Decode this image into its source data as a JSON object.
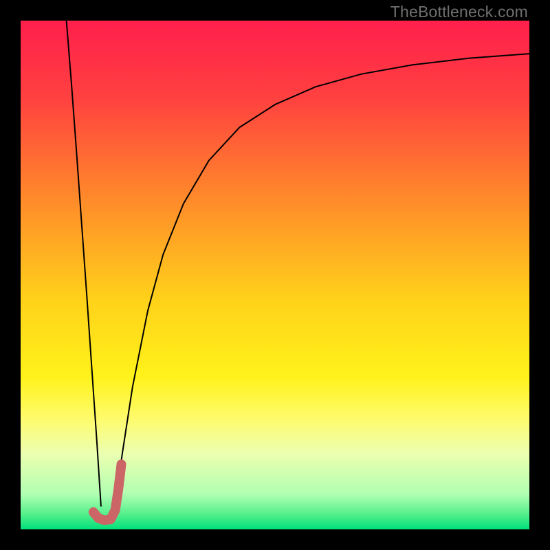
{
  "attribution": "TheBottleneck.com",
  "chart_data": {
    "type": "line",
    "title": "",
    "xlabel": "",
    "ylabel": "",
    "xlim": [
      0,
      100
    ],
    "ylim": [
      0,
      100
    ],
    "grid": false,
    "legend": false,
    "background_gradient": {
      "orientation": "vertical",
      "stops": [
        {
          "pos": 0.0,
          "color": "#ff1f4c"
        },
        {
          "pos": 0.15,
          "color": "#ff4040"
        },
        {
          "pos": 0.35,
          "color": "#ff8a2a"
        },
        {
          "pos": 0.55,
          "color": "#ffd21a"
        },
        {
          "pos": 0.7,
          "color": "#fff21a"
        },
        {
          "pos": 0.78,
          "color": "#fffb6a"
        },
        {
          "pos": 0.85,
          "color": "#ecffb0"
        },
        {
          "pos": 0.93,
          "color": "#b2ffb2"
        },
        {
          "pos": 0.97,
          "color": "#55f08c"
        },
        {
          "pos": 1.0,
          "color": "#00e07a"
        }
      ]
    },
    "series": [
      {
        "name": "left-branch",
        "stroke": "#000000",
        "stroke_width": 2,
        "x": [
          9.0,
          10.0,
          11.0,
          12.0,
          13.0,
          14.0,
          15.0,
          15.8
        ],
        "y": [
          100.0,
          87.5,
          74.0,
          60.0,
          46.0,
          31.5,
          17.0,
          4.5
        ]
      },
      {
        "name": "right-branch",
        "stroke": "#000000",
        "stroke_width": 2,
        "x": [
          18.5,
          20.0,
          22.0,
          25.0,
          28.0,
          32.0,
          37.0,
          43.0,
          50.0,
          58.0,
          67.0,
          77.0,
          88.0,
          100.0
        ],
        "y": [
          4.5,
          15.0,
          28.0,
          43.0,
          54.0,
          64.0,
          72.5,
          79.0,
          83.5,
          87.0,
          89.5,
          91.3,
          92.6,
          93.5
        ]
      },
      {
        "name": "j-marker",
        "stroke": "#cc6666",
        "stroke_width": 14,
        "linecap": "round",
        "x": [
          14.3,
          15.3,
          16.5,
          17.7,
          18.6,
          19.2,
          19.8
        ],
        "y": [
          3.4,
          2.2,
          1.8,
          2.0,
          3.8,
          7.8,
          12.8
        ]
      }
    ]
  }
}
